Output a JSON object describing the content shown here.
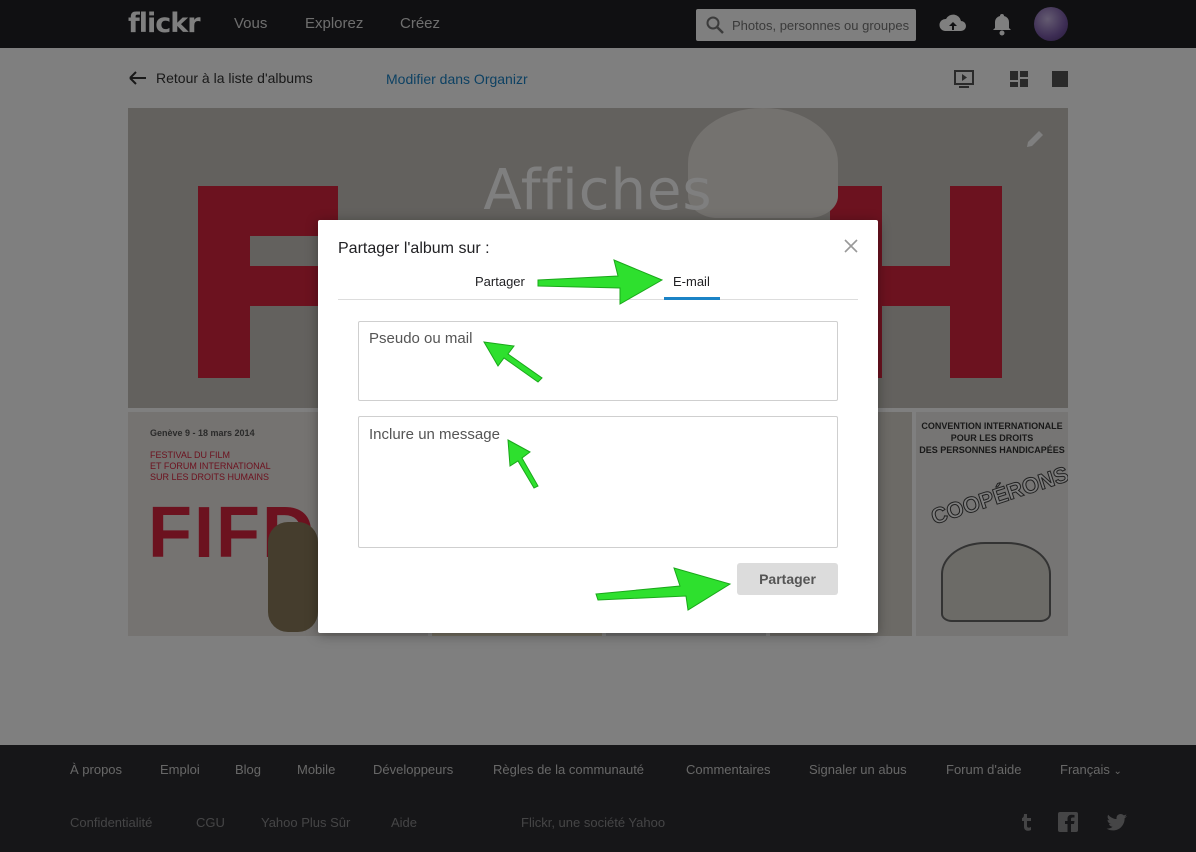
{
  "nav": {
    "logo": "flickr",
    "links": [
      "Vous",
      "Explorez",
      "Créez"
    ],
    "search_placeholder": "Photos, personnes ou groupes"
  },
  "subheader": {
    "back_label": "Retour à la liste d'albums",
    "organizr_label": "Modifier dans Organizr"
  },
  "album": {
    "title": "Affiches"
  },
  "thumbnails": {
    "poster1_date": "Genève 9 - 18 mars 2014",
    "poster1_line1": "FESTIVAL DU FILM",
    "poster1_line2": "ET FORUM INTERNATIONAL",
    "poster1_line3": "SUR LES DROITS HUMAINS",
    "poster1_logo": "FIFD",
    "poster3_line1": "CONVENTION INTERNATIONALE",
    "poster3_line2": "POUR LES DROITS",
    "poster3_line3": "DES PERSONNES HANDICAPÉES",
    "poster3_big": "COOPÉRONS..."
  },
  "dialog": {
    "title": "Partager l'album sur :",
    "tabs": [
      "Partager",
      "E-mail"
    ],
    "active_tab": "E-mail",
    "recipient_placeholder": "Pseudo ou mail",
    "message_placeholder": "Inclure un message",
    "submit_label": "Partager"
  },
  "footer": {
    "row1": [
      "À propos",
      "Emploi",
      "Blog",
      "Mobile",
      "Développeurs",
      "Règles de la communauté",
      "Commentaires",
      "Signaler un abus",
      "Forum d'aide",
      "Français"
    ],
    "row2": [
      "Confidentialité",
      "CGU",
      "Yahoo Plus Sûr",
      "Aide"
    ],
    "company": "Flickr, une société Yahoo"
  },
  "colors": {
    "accent": "#1b83c6",
    "arrow": "#2ee02e",
    "topbar": "#212124",
    "footer": "#2d2d30"
  }
}
